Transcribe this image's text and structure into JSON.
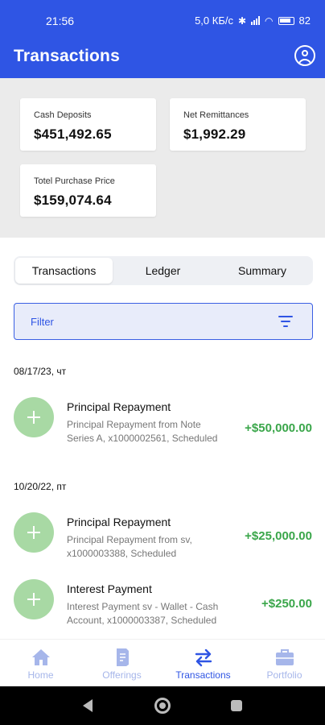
{
  "status_bar": {
    "time": "21:56",
    "speed": "5,0 КБ/с",
    "battery": "82"
  },
  "header": {
    "title": "Transactions"
  },
  "summary": {
    "cash_deposits": {
      "label": "Cash Deposits",
      "value": "$451,492.65"
    },
    "net_remittances": {
      "label": "Net Remittances",
      "value": "$1,992.29"
    },
    "total_purchase_price": {
      "label": "Totel Purchase Price",
      "value": "$159,074.64"
    }
  },
  "tabs": [
    {
      "label": "Transactions",
      "active": true
    },
    {
      "label": "Ledger",
      "active": false
    },
    {
      "label": "Summary",
      "active": false
    }
  ],
  "filter": {
    "label": "Filter"
  },
  "groups": [
    {
      "date": "08/17/23, чт",
      "transactions": [
        {
          "title": "Principal Repayment",
          "description": "Principal Repayment from Note Series A, x1000002561, Scheduled",
          "amount": "+$50,000.00"
        }
      ]
    },
    {
      "date": "10/20/22, пт",
      "transactions": [
        {
          "title": "Principal Repayment",
          "description": "Principal Repayment from sv, x1000003388, Scheduled",
          "amount": "+$25,000.00"
        },
        {
          "title": "Interest Payment",
          "description": "Interest Payment sv - Wallet - Cash Account, x1000003387, Scheduled",
          "amount": "+$250.00"
        }
      ]
    }
  ],
  "bottom_nav": [
    {
      "label": "Home",
      "icon": "home-icon",
      "active": false
    },
    {
      "label": "Offerings",
      "icon": "document-icon",
      "active": false
    },
    {
      "label": "Transactions",
      "icon": "swap-arrows-icon",
      "active": true
    },
    {
      "label": "Portfolio",
      "icon": "briefcase-icon",
      "active": false
    }
  ],
  "colors": {
    "primary": "#2f55e4",
    "positive": "#3aa64a",
    "icon_bg": "#a8d9a4",
    "nav_inactive": "#a6b6ea"
  }
}
